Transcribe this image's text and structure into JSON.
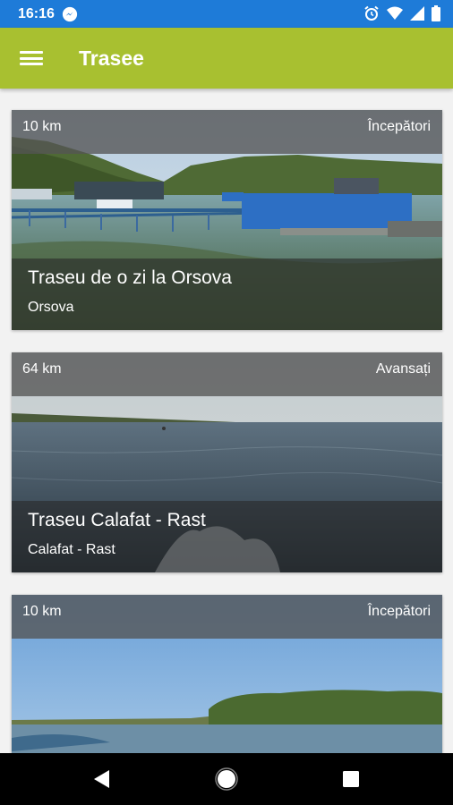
{
  "status_bar": {
    "time": "16:16"
  },
  "app_bar": {
    "title": "Trasee"
  },
  "routes": [
    {
      "distance": "10 km",
      "level": "Începători",
      "title": "Traseu de o zi la Orsova",
      "location": "Orsova"
    },
    {
      "distance": "64 km",
      "level": "Avansați",
      "title": "Traseu Calafat - Rast",
      "location": "Calafat - Rast"
    },
    {
      "distance": "10 km",
      "level": "Începători",
      "title": "",
      "location": ""
    }
  ],
  "colors": {
    "status_bar": "#1e7bd8",
    "app_bar": "#a8c030"
  }
}
